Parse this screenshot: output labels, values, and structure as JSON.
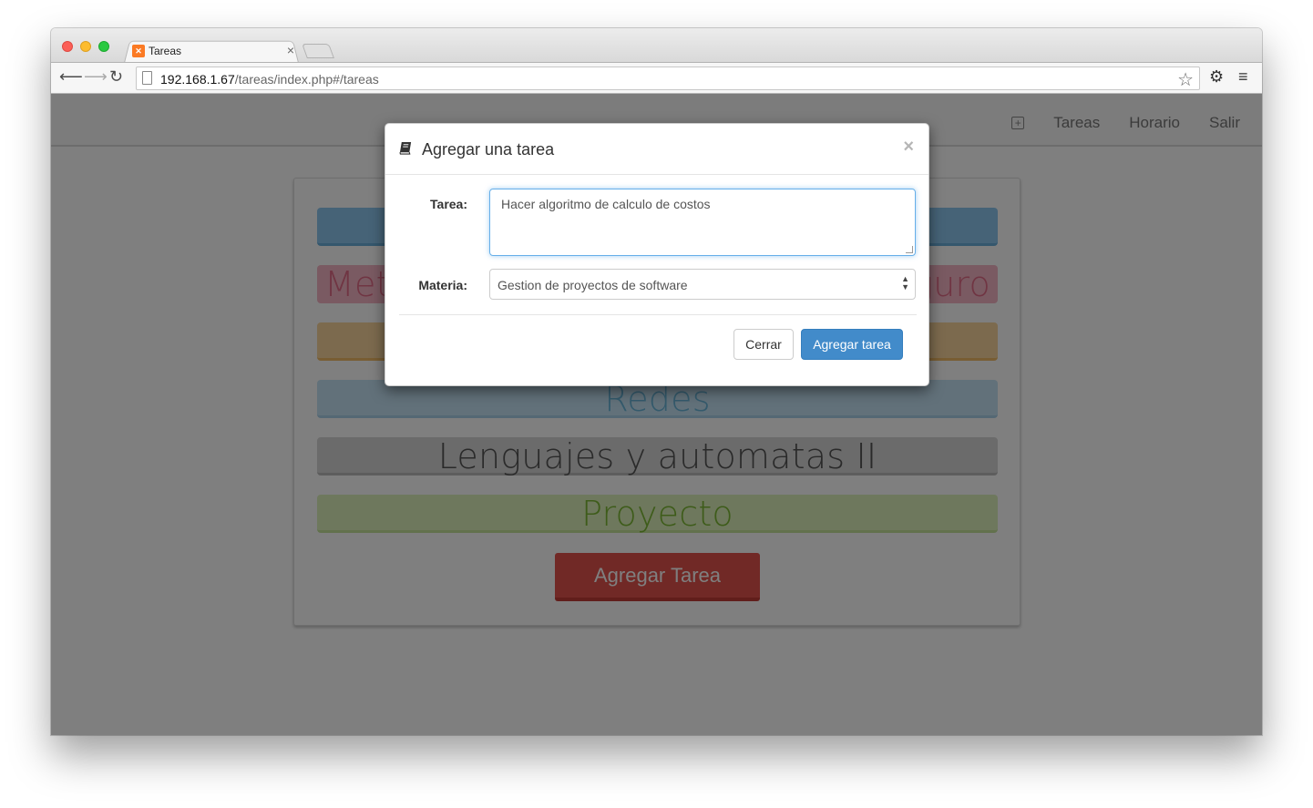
{
  "browser": {
    "tab_title": "Tareas",
    "url_host": "192.168.1.67",
    "url_path": "/tareas/index.php#/tareas"
  },
  "navbar": {
    "links": [
      "Tareas",
      "Horario",
      "Salir"
    ]
  },
  "subjects": {
    "s2_left": "Met",
    "s2_right": "guro",
    "s4": "Redes",
    "s5": "Lenguajes y automatas II",
    "s6": "Proyecto"
  },
  "add_task_button": "Agregar Tarea",
  "modal": {
    "title": "Agregar una tarea",
    "close_symbol": "×",
    "task_label": "Tarea:",
    "task_value": "Hacer algoritmo de calculo de costos",
    "subject_label": "Materia:",
    "subject_value": "Gestion de proyectos de software",
    "cancel_label": "Cerrar",
    "submit_label": "Agregar tarea"
  },
  "colors": {
    "primary": "#428bca",
    "danger": "#e2524c"
  }
}
